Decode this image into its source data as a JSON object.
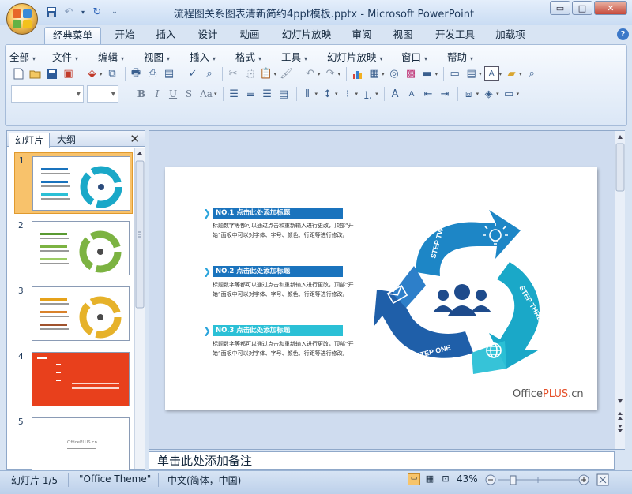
{
  "window": {
    "title": "流程图关系图表清新简约4ppt模板.pptx - Microsoft PowerPoint",
    "min": "▭",
    "max": "□",
    "close": "✕"
  },
  "qat": [
    "save-icon",
    "undo-icon",
    "dropdown-icon",
    "redo-icon",
    "customize-icon"
  ],
  "tabs": [
    "经典菜单",
    "开始",
    "插入",
    "设计",
    "动画",
    "幻灯片放映",
    "审阅",
    "视图",
    "开发工具",
    "加载项"
  ],
  "menus": [
    "全部",
    "文件",
    "编辑",
    "视图",
    "插入",
    "格式",
    "工具",
    "幻灯片放映",
    "窗口",
    "帮助"
  ],
  "format_buttons": [
    "B",
    "I",
    "U",
    "S",
    "Aa"
  ],
  "panel": {
    "tabs": [
      "幻灯片",
      "大纲"
    ],
    "close": "✕",
    "slides": [
      "1",
      "2",
      "3",
      "4",
      "5"
    ],
    "slide5_logo": "OfficePLUS.cn"
  },
  "slide": {
    "items": [
      {
        "heading": "NO.1 点击此处添加标题",
        "body": "标题数字等都可以通过点击和重新输入进行更改，顶部“开始”面板中可以对字体、字号、颜色、行距等进行修改。"
      },
      {
        "heading": "NO.2 点击此处添加标题",
        "body": "标题数字等都可以通过点击和重新输入进行更改，顶部“开始”面板中可以对字体、字号、颜色、行距等进行修改。"
      },
      {
        "heading": "NO.3 点击此处添加标题",
        "body": "标题数字等都可以通过点击和重新输入进行更改，顶部“开始”面板中可以对字体、字号、颜色、行距等进行修改。"
      }
    ],
    "diagram_labels": [
      "STEP TWO",
      "STEP THREE",
      "STEP ONE"
    ],
    "brand_office": "Office",
    "brand_plus": "PLUS",
    "brand_cn": ".cn",
    "colors": {
      "dark_blue": "#1f5fa9",
      "teal": "#1aa8c8",
      "cyan": "#2bc0d6",
      "mid_blue": "#1d86c6",
      "heading_bar": "#1a73bd"
    }
  },
  "notes_placeholder": "单击此处添加备注",
  "status": {
    "slide_count": "幻灯片 1/5",
    "theme": "\"Office Theme\"",
    "language": "中文(简体，中国)",
    "zoom": "43%"
  }
}
